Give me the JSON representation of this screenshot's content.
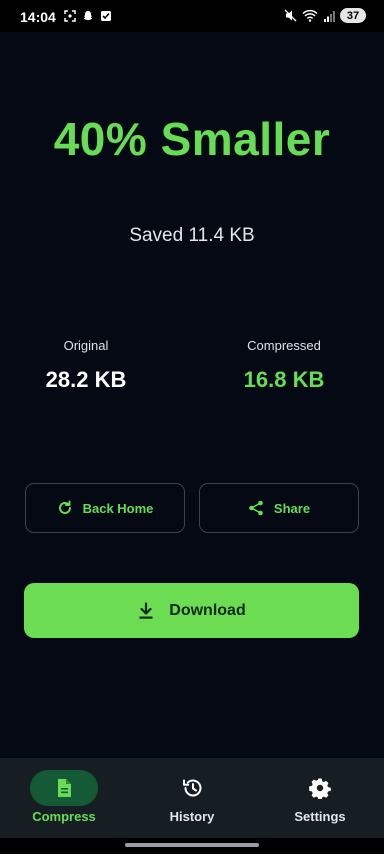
{
  "status_bar": {
    "time": "14:04",
    "left_icons": [
      "screenshot-icon",
      "snapchat-icon",
      "checkbox-icon"
    ],
    "right_icons": [
      "mute-icon",
      "wifi-icon",
      "signal-icon"
    ],
    "battery": "37"
  },
  "result": {
    "headline": "40% Smaller",
    "saved": "Saved 11.4 KB"
  },
  "stats": {
    "original": {
      "label": "Original",
      "value": "28.2 KB"
    },
    "compressed": {
      "label": "Compressed",
      "value": "16.8 KB"
    }
  },
  "actions": {
    "back_home": {
      "label": "Back Home",
      "icon": "refresh-icon"
    },
    "share": {
      "label": "Share",
      "icon": "share-icon"
    },
    "download": {
      "label": "Download",
      "icon": "download-icon"
    }
  },
  "nav": {
    "items": [
      {
        "label": "Compress",
        "icon": "document-icon",
        "active": true
      },
      {
        "label": "History",
        "icon": "history-icon",
        "active": false
      },
      {
        "label": "Settings",
        "icon": "gear-icon",
        "active": false
      }
    ]
  },
  "colors": {
    "background": "#040914",
    "accent": "#66dd55",
    "nav_background": "#161d23",
    "nav_active_pill": "#155a36"
  }
}
